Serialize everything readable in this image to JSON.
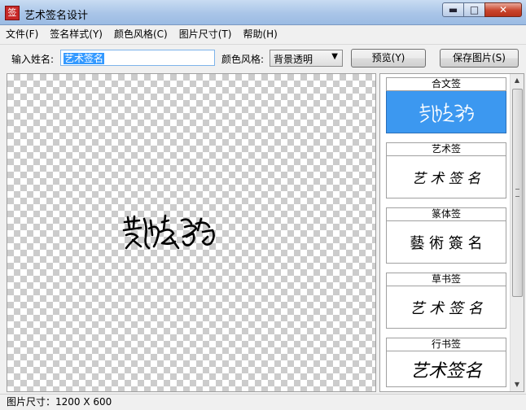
{
  "window": {
    "title": "艺术签名设计",
    "icon_glyph": "签",
    "minimize_glyph": "▬",
    "maximize_glyph": "□",
    "close_glyph": "✕"
  },
  "menu": [
    "文件(F)",
    "签名样式(Y)",
    "颜色风格(C)",
    "图片尺寸(T)",
    "帮助(H)"
  ],
  "toolbar": {
    "name_label": "输入姓名:",
    "name_value": "艺术签名",
    "color_label": "颜色风格:",
    "color_selected": "背景透明",
    "preview_button": "预览(Y)",
    "save_button": "保存图片(S)"
  },
  "styles": [
    {
      "title": "合文签",
      "selected": true
    },
    {
      "title": "艺术签",
      "selected": false
    },
    {
      "title": "篆体签",
      "selected": false
    },
    {
      "title": "草书签",
      "selected": false
    },
    {
      "title": "行书签",
      "selected": false
    }
  ],
  "signature_samples": {
    "hewen": "艺术签名",
    "yishu": "艺 术 签 名",
    "zhuan": "藝 術 簽 名",
    "cao": "艺 术 签 名",
    "xing": "艺术签名"
  },
  "status": {
    "text": "图片尺寸：1200 X 600"
  },
  "colors": {
    "selection": "#3399ff",
    "selected_style_bg": "#3c98f0"
  }
}
